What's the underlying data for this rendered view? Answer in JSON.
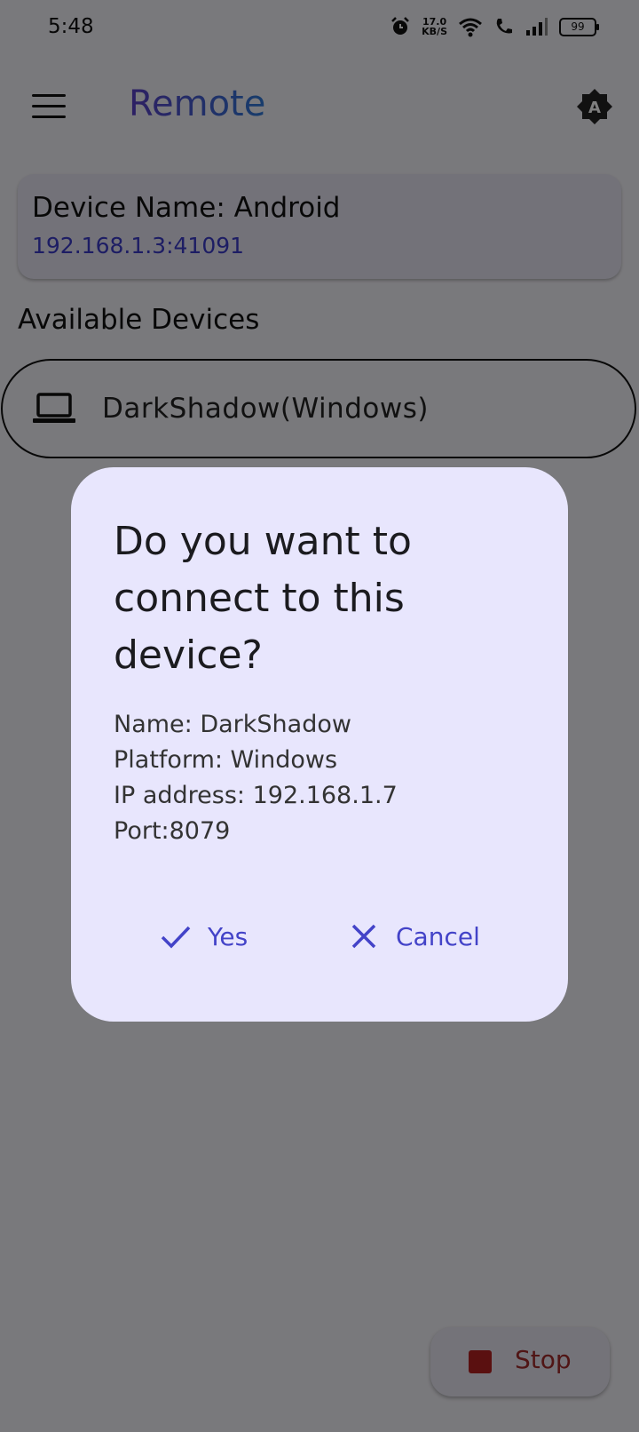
{
  "status_bar": {
    "time": "5:48",
    "speed_value": "17.0",
    "speed_unit": "KB/S",
    "battery": "99"
  },
  "app_bar": {
    "title": "Remote",
    "theme_badge": "A"
  },
  "device_card": {
    "name": "Device Name: Android",
    "address": "192.168.1.3:41091"
  },
  "available": {
    "title": "Available Devices",
    "devices": [
      {
        "label": "DarkShadow(Windows)",
        "icon": "laptop-icon"
      }
    ]
  },
  "dialog": {
    "title": "Do you want to connect to this device?",
    "lines": [
      "Name: DarkShadow",
      "Platform: Windows",
      "IP address: 192.168.1.7",
      "Port:8079"
    ],
    "yes_label": "Yes",
    "cancel_label": "Cancel"
  },
  "fab": {
    "stop_label": "Stop"
  },
  "colors": {
    "accent": "#4343c8",
    "stop": "#b52020",
    "dialog_bg": "#e8e6fd"
  }
}
